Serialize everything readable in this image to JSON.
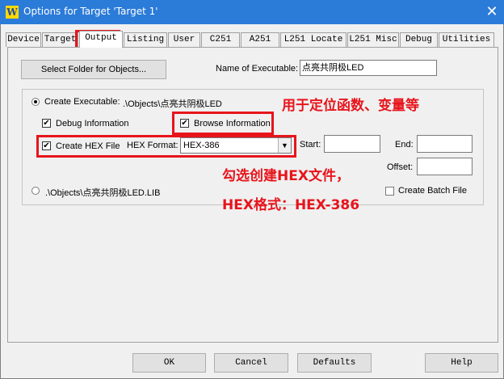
{
  "window": {
    "title": "Options for Target 'Target 1'",
    "close_icon": "close-icon",
    "app_icon_glyph": "W"
  },
  "tabs": [
    {
      "label": "Device"
    },
    {
      "label": "Target"
    },
    {
      "label": "Output"
    },
    {
      "label": "Listing"
    },
    {
      "label": "User"
    },
    {
      "label": "C251"
    },
    {
      "label": "A251"
    },
    {
      "label": "L251 Locate"
    },
    {
      "label": "L251 Misc"
    },
    {
      "label": "Debug"
    },
    {
      "label": "Utilities"
    }
  ],
  "output": {
    "select_folder_label": "Select Folder for Objects...",
    "name_exec_label": "Name of Executable:",
    "name_exec_value": "点亮共阴极LED",
    "create_exec_label": "Create Executable:",
    "create_exec_path": ".\\Objects\\点亮共阴极LED",
    "debug_info_label": "Debug Information",
    "browse_info_label": "Browse Information",
    "create_hex_label": "Create HEX File",
    "hex_format_label": "HEX Format:",
    "hex_format_value": "HEX-386",
    "start_label": "Start:",
    "end_label": "End:",
    "offset_label": "Offset:",
    "lib_path": ".\\Objects\\点亮共阴极LED.LIB",
    "create_batch_label": "Create Batch File",
    "create_exec_checked": true,
    "debug_info_checked": true,
    "browse_info_checked": true,
    "create_hex_checked": true,
    "create_batch_checked": false
  },
  "annotations": {
    "browse_note": "用于定位函数、变量等",
    "hex_note_line1": "勾选创建HEX文件，",
    "hex_note_line2": "HEX格式：HEX-386",
    "color": "#e8141c"
  },
  "buttons": {
    "ok": "OK",
    "cancel": "Cancel",
    "defaults": "Defaults",
    "help": "Help"
  },
  "check_glyph": "✔"
}
